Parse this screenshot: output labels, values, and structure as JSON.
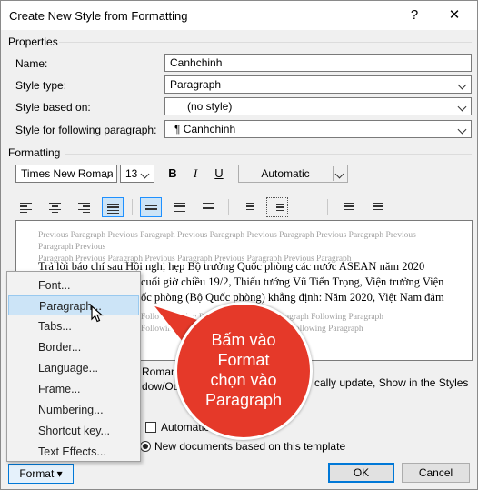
{
  "window": {
    "title": "Create New Style from Formatting",
    "help_glyph": "?",
    "close_glyph": "✕"
  },
  "properties": {
    "header": "Properties",
    "name_label": "Name:",
    "name_value": "Canhchinh",
    "style_type_label": "Style type:",
    "style_type_value": "Paragraph",
    "based_on_label": "Style based on:",
    "based_on_value": "(no style)",
    "following_label": "Style for following paragraph:",
    "following_value": "¶  Canhchinh"
  },
  "formatting": {
    "header": "Formatting",
    "font": "Times New Roman",
    "size": "13",
    "bold": "B",
    "italic": "I",
    "underline": "U",
    "color": "Automatic"
  },
  "preview": {
    "previous_1": "Previous Paragraph Previous Paragraph Previous Paragraph Previous Paragraph Previous Paragraph Previous Paragraph Previous",
    "previous_2": "Paragraph Previous Paragraph Previous Paragraph Previous Paragraph Previous Paragraph",
    "line_1": "Trả lời báo chí sau Hội nghị hẹp Bộ trưởng Quốc phòng các nước ASEAN năm 2020",
    "line_2": "cuối giờ chiều 19/2, Thiếu tướng Vũ Tiến Trọng, Viện trưởng Viện",
    "line_3": "ốc phòng (Bộ Quốc phòng) khẳng định: Năm 2020, Việt Nam đảm",
    "following_1": "Follo Following Paragraph Following Paragraph Following Paragraph",
    "following_2": "Following Paragraph Following Paragraph Following Paragraph"
  },
  "description": {
    "line_1": "Roman,",
    "line_2": "dow/Ou",
    "line_3": "cally update, Show in the Styles"
  },
  "options": {
    "auto_update_label": "Automatic",
    "new_docs_label": "New documents based on this template"
  },
  "format_menu": {
    "items": [
      "Font...",
      "Paragraph...",
      "Tabs...",
      "Border...",
      "Language...",
      "Frame...",
      "Numbering...",
      "Shortcut key...",
      "Text Effects..."
    ],
    "highlighted": "Paragraph..."
  },
  "callout": {
    "text_line_1": "Bấm vào",
    "text_line_2": "Format",
    "text_line_3": "chọn vào",
    "text_line_4": "Paragraph",
    "color": "#e53929"
  },
  "buttons": {
    "format": "Format ▾",
    "ok": "OK",
    "cancel": "Cancel"
  },
  "colors": {
    "accent": "#0078d7",
    "selection": "#cce4f7"
  }
}
